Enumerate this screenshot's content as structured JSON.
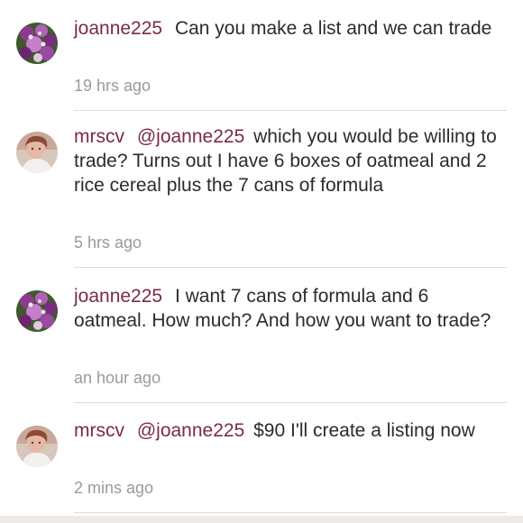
{
  "comments": [
    {
      "username": "joanne225",
      "mention": "",
      "text": "Can you make a list and we can trade",
      "time": "19 hrs ago",
      "avatar": "flower-bouquet-avatar"
    },
    {
      "username": "mrscv",
      "mention": "@joanne225",
      "text": "which you would be willing to trade? Turns out I have 6 boxes of oatmeal and 2 rice cereal plus the 7 cans of formula",
      "time": "5 hrs ago",
      "avatar": "person-photo-avatar"
    },
    {
      "username": "joanne225",
      "mention": "",
      "text": "I want 7 cans of formula and 6 oatmeal. How much? And how you want to trade?",
      "time": "an hour ago",
      "avatar": "flower-bouquet-avatar"
    },
    {
      "username": "mrscv",
      "mention": "@joanne225",
      "text": "$90  I'll create a listing now",
      "time": "2 mins ago",
      "avatar": "person-photo-avatar"
    }
  ],
  "colors": {
    "username": "#7a2a48",
    "text": "#2b2b2b",
    "timestamp": "#9a9a9a",
    "divider": "#dddddd"
  }
}
